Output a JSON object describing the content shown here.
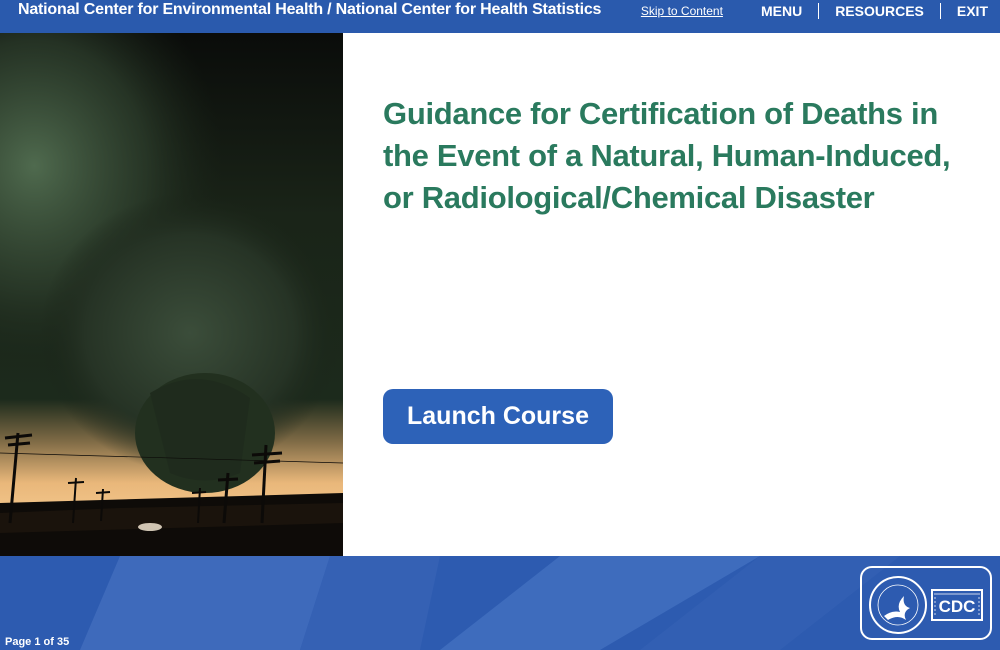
{
  "header": {
    "org_title": "National Center for Environmental Health / National Center for Health Statistics",
    "skip_link": "Skip to Content",
    "nav": [
      "MENU",
      "RESOURCES",
      "EXIT"
    ]
  },
  "hero": {
    "image_subject": "tornado"
  },
  "main": {
    "title": "Guidance for Certification of Deaths in the Event of a Natural, Human-Induced, or Radiological/Chemical Disaster",
    "launch_button": "Launch Course"
  },
  "footer": {
    "page_indicator": "Page 1 of 35",
    "logo_text": "CDC"
  },
  "colors": {
    "header_bg": "#2a5aad",
    "title_text": "#2a7a5e",
    "button_bg": "#2d62b8",
    "footer_bg": "#2d5bb0"
  }
}
